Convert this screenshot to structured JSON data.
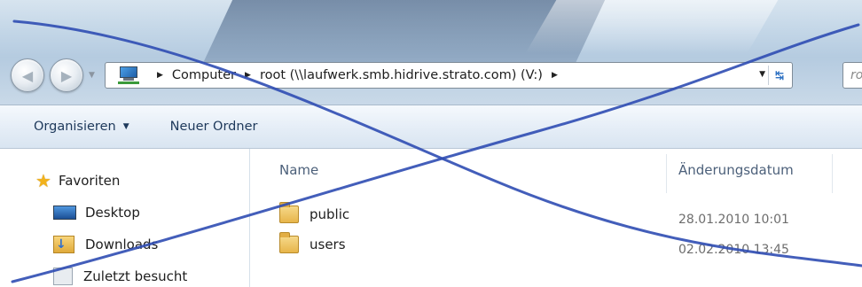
{
  "toolbar": {
    "back_icon": "arrow-left-icon",
    "forward_icon": "arrow-right-icon",
    "address": {
      "icon": "computer-icon",
      "crumbs": [
        "Computer",
        "root (\\\\laufwerk.smb.hidrive.strato.com) (V:)"
      ],
      "refresh_icon": "refresh-icon"
    },
    "search_placeholder": "ro"
  },
  "command_bar": {
    "organize_label": "Organisieren",
    "new_folder_label": "Neuer Ordner"
  },
  "nav_pane": {
    "favorites_label": "Favoriten",
    "items": [
      {
        "label": "Desktop",
        "icon": "desktop-icon"
      },
      {
        "label": "Downloads",
        "icon": "downloads-icon"
      },
      {
        "label": "Zuletzt besucht",
        "icon": "recent-places-icon"
      }
    ]
  },
  "file_list": {
    "columns": [
      "Name",
      "Änderungsdatum"
    ],
    "rows": [
      {
        "name": "public",
        "date": "28.01.2010 10:01",
        "icon": "folder-icon"
      },
      {
        "name": "users",
        "date": "02.02.2010 13:45",
        "icon": "folder-icon"
      }
    ]
  },
  "colors": {
    "marker": "#2f4db3",
    "command_text": "#1e395b",
    "header_text": "#4c607a"
  }
}
